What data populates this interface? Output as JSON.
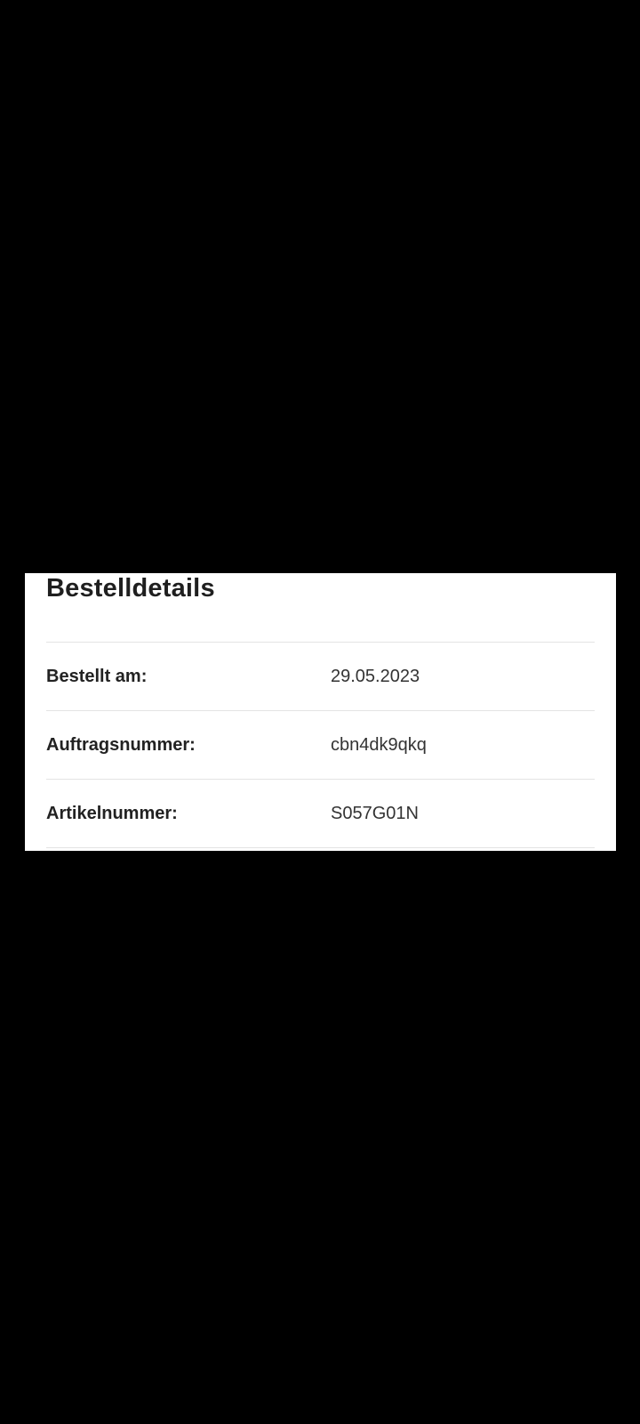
{
  "order_details": {
    "title": "Bestelldetails",
    "rows": [
      {
        "label": "Bestellt am:",
        "value": "29.05.2023"
      },
      {
        "label": "Auftragsnummer:",
        "value": "cbn4dk9qkq"
      },
      {
        "label": "Artikelnummer:",
        "value": "S057G01N"
      }
    ]
  },
  "colors": {
    "background": "#000000",
    "card": "#ffffff",
    "text": "#222222",
    "divider": "#e3e3e3"
  }
}
